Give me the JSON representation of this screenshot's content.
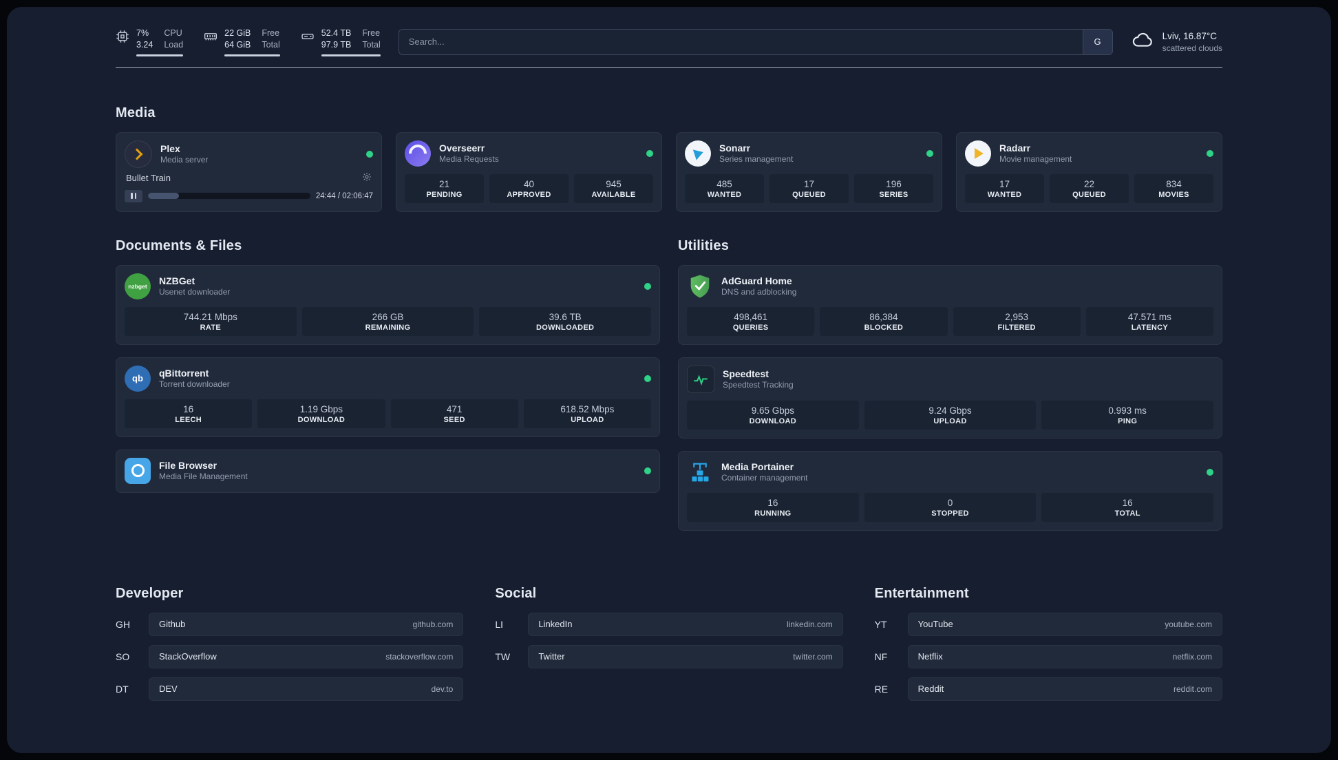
{
  "topbar": {
    "resources": [
      {
        "col1_top": "7%",
        "col1_bottom": "3.24",
        "col2_top": "CPU",
        "col2_bottom": "Load"
      },
      {
        "col1_top": "22 GiB",
        "col1_bottom": "64 GiB",
        "col2_top": "Free",
        "col2_bottom": "Total"
      },
      {
        "col1_top": "52.4 TB",
        "col1_bottom": "97.9 TB",
        "col2_top": "Free",
        "col2_bottom": "Total"
      }
    ],
    "search": {
      "placeholder": "Search...",
      "provider_label": "G"
    },
    "weather": {
      "location": "Lviv, 16.87°C",
      "condition": "scattered clouds"
    }
  },
  "media": {
    "heading": "Media",
    "plex": {
      "name": "Plex",
      "desc": "Media server",
      "track": "Bullet Train",
      "time": "24:44 / 02:06:47",
      "progress_pct": 19
    },
    "overseerr": {
      "name": "Overseerr",
      "desc": "Media Requests",
      "stats": [
        {
          "value": "21",
          "label": "PENDING"
        },
        {
          "value": "40",
          "label": "APPROVED"
        },
        {
          "value": "945",
          "label": "AVAILABLE"
        }
      ]
    },
    "sonarr": {
      "name": "Sonarr",
      "desc": "Series management",
      "stats": [
        {
          "value": "485",
          "label": "WANTED"
        },
        {
          "value": "17",
          "label": "QUEUED"
        },
        {
          "value": "196",
          "label": "SERIES"
        }
      ]
    },
    "radarr": {
      "name": "Radarr",
      "desc": "Movie management",
      "stats": [
        {
          "value": "17",
          "label": "WANTED"
        },
        {
          "value": "22",
          "label": "QUEUED"
        },
        {
          "value": "834",
          "label": "MOVIES"
        }
      ]
    }
  },
  "documents": {
    "heading": "Documents & Files",
    "nzbget": {
      "name": "NZBGet",
      "desc": "Usenet downloader",
      "stats": [
        {
          "value": "744.21 Mbps",
          "label": "RATE"
        },
        {
          "value": "266 GB",
          "label": "REMAINING"
        },
        {
          "value": "39.6 TB",
          "label": "DOWNLOADED"
        }
      ]
    },
    "qbittorrent": {
      "name": "qBittorrent",
      "desc": "Torrent downloader",
      "stats": [
        {
          "value": "16",
          "label": "LEECH"
        },
        {
          "value": "1.19 Gbps",
          "label": "DOWNLOAD"
        },
        {
          "value": "471",
          "label": "SEED"
        },
        {
          "value": "618.52 Mbps",
          "label": "UPLOAD"
        }
      ]
    },
    "filebrowser": {
      "name": "File Browser",
      "desc": "Media File Management"
    }
  },
  "utilities": {
    "heading": "Utilities",
    "adguard": {
      "name": "AdGuard Home",
      "desc": "DNS and adblocking",
      "stats": [
        {
          "value": "498,461",
          "label": "QUERIES"
        },
        {
          "value": "86,384",
          "label": "BLOCKED"
        },
        {
          "value": "2,953",
          "label": "FILTERED"
        },
        {
          "value": "47.571 ms",
          "label": "LATENCY"
        }
      ]
    },
    "speedtest": {
      "name": "Speedtest",
      "desc": "Speedtest Tracking",
      "stats": [
        {
          "value": "9.65 Gbps",
          "label": "DOWNLOAD"
        },
        {
          "value": "9.24 Gbps",
          "label": "UPLOAD"
        },
        {
          "value": "0.993 ms",
          "label": "PING"
        }
      ]
    },
    "portainer": {
      "name": "Media Portainer",
      "desc": "Container management",
      "stats": [
        {
          "value": "16",
          "label": "RUNNING"
        },
        {
          "value": "0",
          "label": "STOPPED"
        },
        {
          "value": "16",
          "label": "TOTAL"
        }
      ]
    }
  },
  "bookmarks": {
    "developer": {
      "heading": "Developer",
      "items": [
        {
          "abbr": "GH",
          "name": "Github",
          "url": "github.com"
        },
        {
          "abbr": "SO",
          "name": "StackOverflow",
          "url": "stackoverflow.com"
        },
        {
          "abbr": "DT",
          "name": "DEV",
          "url": "dev.to"
        }
      ]
    },
    "social": {
      "heading": "Social",
      "items": [
        {
          "abbr": "LI",
          "name": "LinkedIn",
          "url": "linkedin.com"
        },
        {
          "abbr": "TW",
          "name": "Twitter",
          "url": "twitter.com"
        }
      ]
    },
    "entertainment": {
      "heading": "Entertainment",
      "items": [
        {
          "abbr": "YT",
          "name": "YouTube",
          "url": "youtube.com"
        },
        {
          "abbr": "NF",
          "name": "Netflix",
          "url": "netflix.com"
        },
        {
          "abbr": "RE",
          "name": "Reddit",
          "url": "reddit.com"
        }
      ]
    }
  },
  "icons": {
    "nzbget_text": "nzbget",
    "qbittorrent_text": "qb"
  },
  "colors": {
    "status_green": "#2fd387",
    "plex_gold": "#e5a00d",
    "background": "#161e30",
    "card": "#212a3b"
  }
}
